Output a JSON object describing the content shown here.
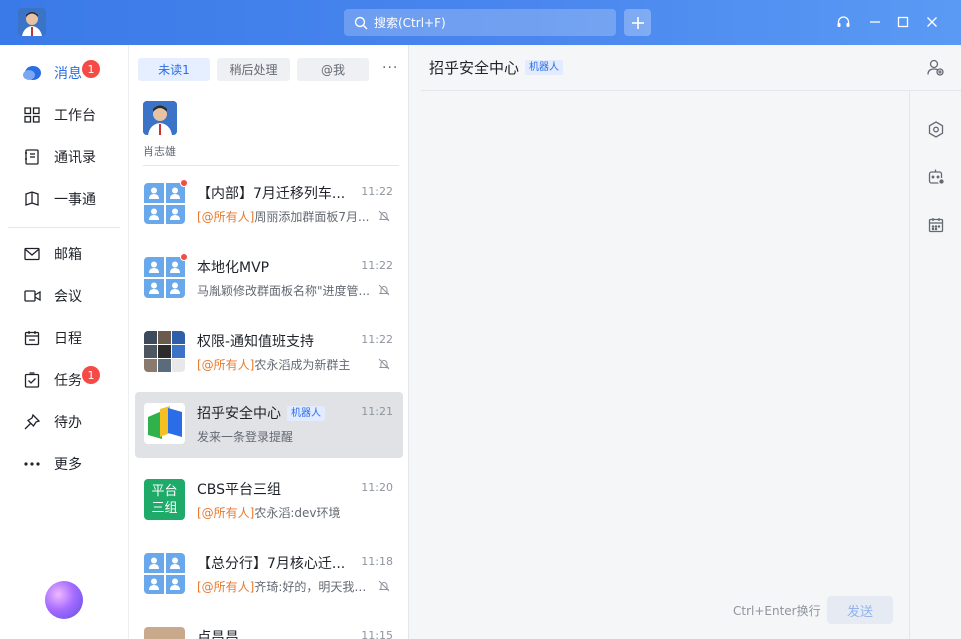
{
  "titlebar": {
    "search_placeholder": "搜索(Ctrl+F)"
  },
  "nav": {
    "items": [
      {
        "label": "消息",
        "badge": "1"
      },
      {
        "label": "工作台"
      },
      {
        "label": "通讯录"
      },
      {
        "label": "一事通"
      },
      {
        "label": "邮箱"
      },
      {
        "label": "会议"
      },
      {
        "label": "日程"
      },
      {
        "label": "任务",
        "badge": "1"
      },
      {
        "label": "待办"
      },
      {
        "label": "更多"
      }
    ]
  },
  "filters": [
    "未读1",
    "稍后处理",
    "@我"
  ],
  "pinned": {
    "name": "肖志雄"
  },
  "conversations": [
    {
      "name": "【内部】7月迁移列车...",
      "time": "11:22",
      "mention": "[@所有人]",
      "preview": "周丽添加群面板7月...",
      "unread_dot": true,
      "muted": true
    },
    {
      "name": "本地化MVP",
      "time": "11:22",
      "mention": "",
      "preview": "马胤颖修改群面板名称\"进度管...",
      "unread_dot": true,
      "muted": true
    },
    {
      "name": "权限-通知值班支持",
      "time": "11:22",
      "mention": "[@所有人]",
      "preview": "农永滔成为新群主",
      "unread_dot": false,
      "muted": true
    },
    {
      "name": "招乎安全中心",
      "tag": "机器人",
      "time": "11:21",
      "mention": "",
      "preview": "发来一条登录提醒",
      "unread_dot": false,
      "muted": false
    },
    {
      "name": "CBS平台三组",
      "time": "11:20",
      "mention": "[@所有人]",
      "preview": "农永滔:dev环境",
      "unread_dot": false,
      "muted": false,
      "avatar_text": [
        "平台",
        "三组"
      ]
    },
    {
      "name": "【总分行】7月核心迁...",
      "time": "11:18",
      "mention": "[@所有人]",
      "preview": "齐琦:好的，明天我们...",
      "unread_dot": false,
      "muted": true
    },
    {
      "name": "卢昌昌",
      "time": "11:15",
      "mention": "",
      "preview": "",
      "unread_dot": false,
      "muted": false
    }
  ],
  "chat": {
    "title": "招乎安全中心",
    "tag": "机器人",
    "hint": "Ctrl+Enter换行",
    "send_label": "发送"
  },
  "colors": {
    "accent": "#2b6de6",
    "badge": "#f54a45",
    "mention": "#e8792c",
    "titlebar": "#4a86ee"
  }
}
